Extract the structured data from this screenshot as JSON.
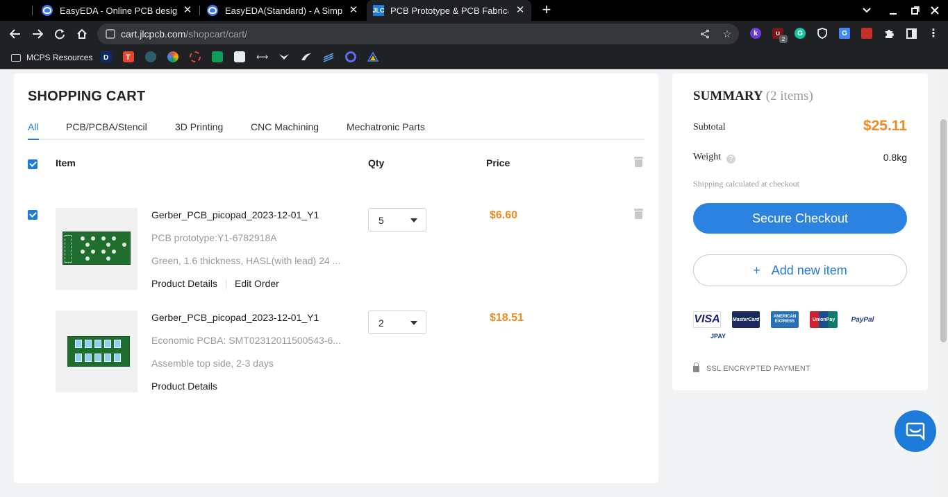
{
  "browser": {
    "tabs": [
      {
        "title": "EasyEDA - Online PCB design & c"
      },
      {
        "title": "EasyEDA(Standard) - A Simple a"
      },
      {
        "title": "PCB Prototype & PCB Fabricatio",
        "active": true
      }
    ],
    "jlc_favicon": "JLC",
    "url_host": "cart.jlcpcb.com",
    "url_path": "/shopcart/cart/",
    "ext_badge": "2",
    "bookmark_folder": "MCPS Resources"
  },
  "cart": {
    "title": "SHOPPING CART",
    "categories": [
      "All",
      "PCB/PCBA/Stencil",
      "3D Printing",
      "CNC Machining",
      "Mechatronic Parts"
    ],
    "columns": {
      "item": "Item",
      "qty": "Qty",
      "price": "Price"
    },
    "items": [
      {
        "name": "Gerber_PCB_picopad_2023-12-01_Y1",
        "line1": "PCB prototype:Y1-6782918A",
        "line2": "Green, 1.6 thickness, HASL(with lead) 24 ...",
        "qty": "5",
        "price": "$6.60",
        "links": [
          "Product Details",
          "Edit Order"
        ]
      },
      {
        "name": "Gerber_PCB_picopad_2023-12-01_Y1",
        "line1": "Economic PCBA: SMT02312011500543-6...",
        "line2": "Assemble top side, 2-3 days",
        "qty": "2",
        "price": "$18.51",
        "links": [
          "Product Details"
        ]
      }
    ]
  },
  "summary": {
    "title": "SUMMARY",
    "count": "(2 items)",
    "subtotal_label": "Subtotal",
    "subtotal": "$25.11",
    "weight_label": "Weight",
    "weight": "0.8kg",
    "help": "?",
    "shipping_note": "Shipping calculated at checkout",
    "checkout": "Secure Checkout",
    "add_plus": "+",
    "add_item": "Add new item",
    "payments": [
      "VISA",
      "MasterCard",
      "AMERICAN EXPRESS",
      "UnionPay",
      "PayPal",
      "JPAY"
    ],
    "ssl": "SSL ENCRYPTED PAYMENT"
  },
  "colors": {
    "accent": "#1f7bd9",
    "price": "#f08a20",
    "checkout": "#2b82e0"
  }
}
